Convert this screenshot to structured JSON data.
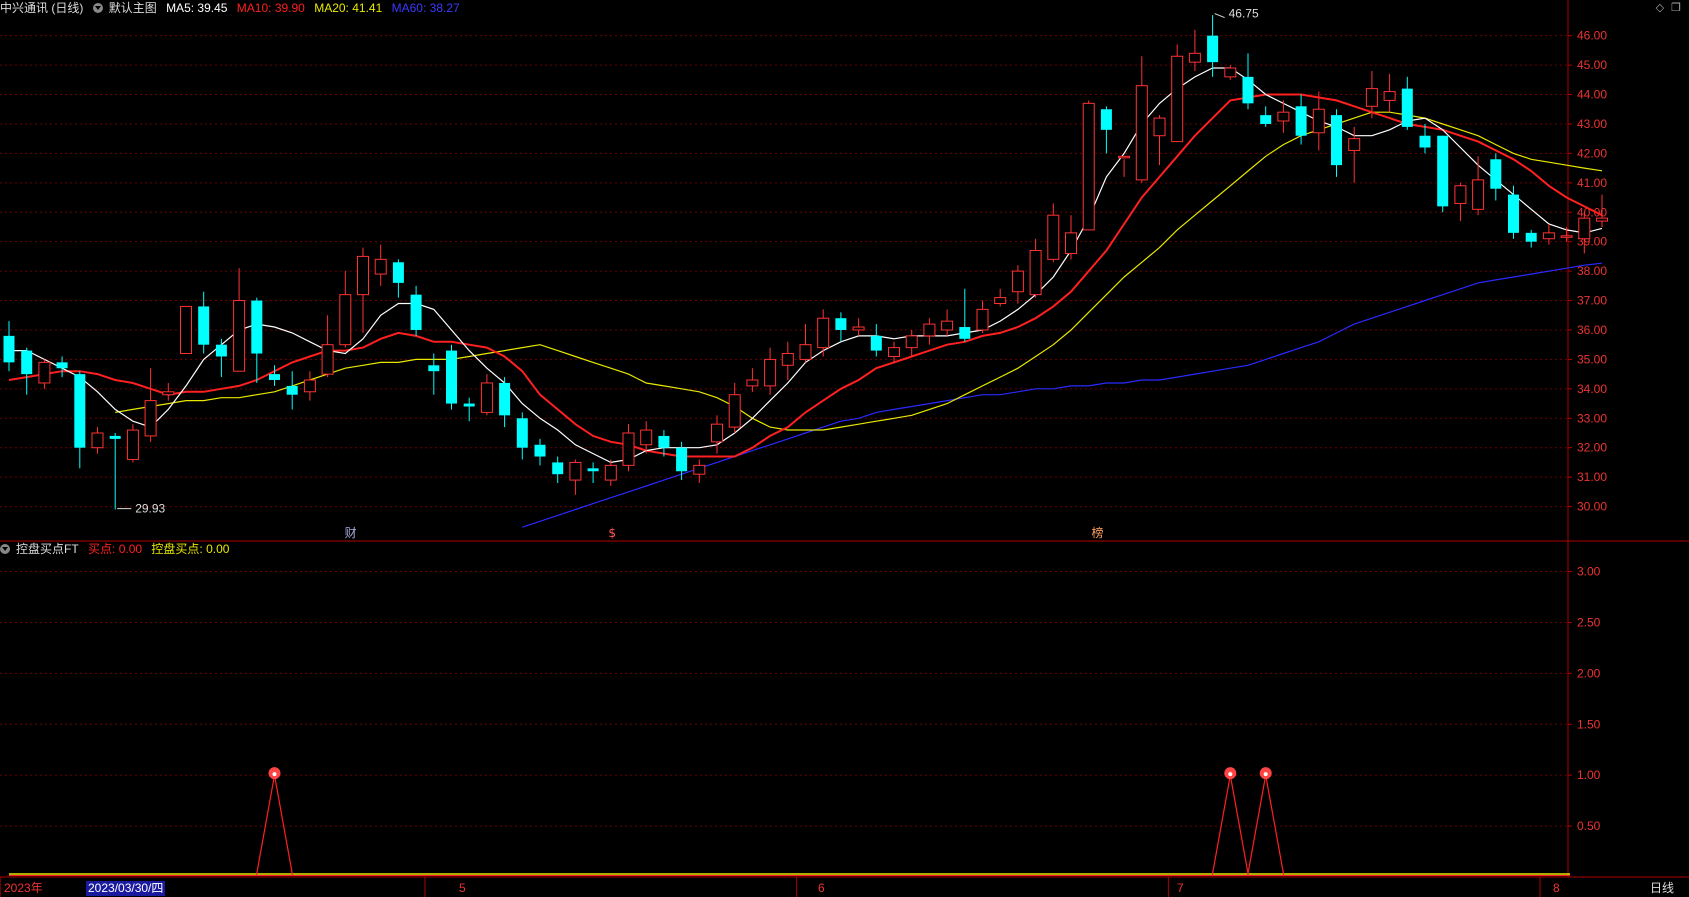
{
  "header": {
    "stock": "中兴通讯",
    "period": "(日线)",
    "template": "默认主图",
    "ma5_label": "MA5:",
    "ma5_value": "39.45",
    "ma10_label": "MA10:",
    "ma10_value": "39.90",
    "ma20_label": "MA20:",
    "ma20_value": "41.41",
    "ma60_label": "MA60:",
    "ma60_value": "38.27"
  },
  "window_tools": {
    "diamond": "◇",
    "restore": "❐"
  },
  "indicator": {
    "name": "控盘买点FT",
    "buy_label": "买点:",
    "buy_value": "0.00",
    "ctrl_label": "控盘买点:",
    "ctrl_value": "0.00"
  },
  "colors": {
    "up": "#ff3232",
    "down": "#00ffff",
    "ma5": "#ffffff",
    "ma10": "#ff2020",
    "ma20": "#e8e800",
    "ma60": "#2a2aff",
    "grid": "#6e0000",
    "axis_text": "#ee3333"
  },
  "markers": {
    "high": "46.75",
    "low": "29.93"
  },
  "events": [
    "财",
    "$",
    "榜"
  ],
  "footer": {
    "year": "2023年",
    "cursor_date": "2023/03/30/四",
    "months": [
      "5",
      "6",
      "7",
      "8"
    ],
    "period_button": "日线"
  },
  "chart_data": [
    {
      "type": "candlestick",
      "title": "中兴通讯 (日线)",
      "ylim": [
        29.0,
        46.6
      ],
      "yticks": [
        "46.00",
        "45.00",
        "44.00",
        "43.00",
        "42.00",
        "41.00",
        "40.00",
        "39.00",
        "38.00",
        "37.00",
        "36.00",
        "35.00",
        "34.00",
        "33.00",
        "32.00",
        "31.00",
        "30.00"
      ],
      "candles": [
        [
          35.8,
          34.9,
          36.3,
          34.6
        ],
        [
          35.3,
          34.5,
          35.4,
          33.8
        ],
        [
          34.2,
          34.9,
          35.0,
          34.0
        ],
        [
          34.9,
          34.7,
          35.1,
          34.4
        ],
        [
          34.5,
          32.0,
          34.6,
          31.3
        ],
        [
          32.0,
          32.5,
          32.7,
          31.8
        ],
        [
          32.4,
          32.3,
          32.5,
          29.9
        ],
        [
          31.6,
          32.6,
          32.8,
          31.5
        ],
        [
          32.4,
          33.6,
          34.7,
          32.2
        ],
        [
          33.8,
          33.9,
          34.2,
          33.6
        ],
        [
          35.2,
          36.8,
          36.8,
          35.2
        ],
        [
          36.8,
          35.5,
          37.3,
          35.2
        ],
        [
          35.5,
          35.1,
          35.7,
          34.4
        ],
        [
          34.6,
          37.0,
          38.1,
          34.6
        ],
        [
          37.0,
          35.2,
          37.1,
          34.2
        ],
        [
          34.5,
          34.3,
          34.8,
          34.1
        ],
        [
          34.1,
          33.8,
          34.6,
          33.3
        ],
        [
          33.9,
          34.3,
          34.6,
          33.6
        ],
        [
          34.5,
          35.5,
          36.5,
          34.4
        ],
        [
          35.5,
          37.2,
          38.0,
          35.4
        ],
        [
          37.2,
          38.5,
          38.8,
          35.9
        ],
        [
          37.9,
          38.4,
          38.9,
          37.5
        ],
        [
          38.3,
          37.6,
          38.4,
          37.1
        ],
        [
          37.2,
          36.0,
          37.5,
          35.8
        ],
        [
          34.8,
          34.6,
          35.2,
          33.8
        ],
        [
          35.3,
          33.5,
          35.5,
          33.3
        ],
        [
          33.5,
          33.4,
          33.7,
          32.9
        ],
        [
          33.2,
          34.2,
          34.5,
          33.1
        ],
        [
          34.2,
          33.1,
          34.4,
          32.7
        ],
        [
          33.0,
          32.0,
          33.2,
          31.6
        ],
        [
          32.1,
          31.7,
          32.3,
          31.4
        ],
        [
          31.5,
          31.1,
          31.7,
          30.8
        ],
        [
          30.9,
          31.5,
          31.6,
          30.4
        ],
        [
          31.3,
          31.2,
          31.5,
          30.8
        ],
        [
          30.9,
          31.4,
          31.6,
          30.7
        ],
        [
          31.4,
          32.5,
          32.8,
          31.2
        ],
        [
          32.1,
          32.6,
          32.9,
          31.8
        ],
        [
          32.4,
          32.0,
          32.6,
          31.7
        ],
        [
          32.0,
          31.2,
          32.2,
          30.9
        ],
        [
          31.1,
          31.4,
          31.6,
          30.8
        ],
        [
          32.2,
          32.8,
          33.1,
          31.8
        ],
        [
          32.7,
          33.8,
          34.2,
          32.5
        ],
        [
          34.1,
          34.3,
          34.7,
          33.9
        ],
        [
          34.1,
          35.0,
          35.4,
          33.8
        ],
        [
          34.8,
          35.2,
          35.6,
          34.3
        ],
        [
          35.0,
          35.5,
          36.2,
          34.9
        ],
        [
          35.4,
          36.4,
          36.7,
          35.1
        ],
        [
          36.4,
          36.0,
          36.6,
          35.6
        ],
        [
          36.0,
          36.1,
          36.4,
          35.8
        ],
        [
          35.8,
          35.3,
          36.2,
          35.1
        ],
        [
          35.1,
          35.4,
          35.6,
          34.9
        ],
        [
          35.4,
          35.8,
          36.0,
          35.1
        ],
        [
          35.8,
          36.2,
          36.4,
          35.5
        ],
        [
          36.0,
          36.3,
          36.7,
          35.8
        ],
        [
          36.1,
          35.7,
          37.4,
          35.6
        ],
        [
          36.0,
          36.7,
          37.0,
          35.9
        ],
        [
          36.9,
          37.1,
          37.4,
          36.8
        ],
        [
          37.3,
          38.0,
          38.2,
          36.9
        ],
        [
          37.2,
          38.7,
          39.1,
          37.1
        ],
        [
          38.4,
          39.9,
          40.3,
          38.3
        ],
        [
          38.6,
          39.3,
          39.9,
          38.4
        ],
        [
          39.4,
          43.7,
          43.8,
          39.6
        ],
        [
          43.5,
          42.8,
          43.6,
          42.0
        ],
        [
          41.9,
          41.9,
          41.8,
          41.2
        ],
        [
          41.1,
          44.3,
          45.3,
          41.0
        ],
        [
          42.6,
          43.2,
          43.3,
          41.6
        ],
        [
          42.4,
          45.3,
          45.7,
          42.4
        ],
        [
          45.1,
          45.4,
          46.2,
          44.8
        ],
        [
          46.0,
          45.1,
          46.7,
          44.6
        ],
        [
          44.6,
          44.9,
          45.0,
          44.5
        ],
        [
          44.6,
          43.7,
          45.4,
          43.5
        ],
        [
          43.3,
          43.0,
          43.6,
          42.9
        ],
        [
          43.1,
          43.4,
          43.8,
          42.7
        ],
        [
          43.6,
          42.6,
          44.0,
          42.3
        ],
        [
          42.7,
          43.5,
          44.1,
          42.1
        ],
        [
          43.3,
          41.6,
          43.5,
          41.2
        ],
        [
          42.1,
          42.5,
          42.9,
          41.0
        ],
        [
          43.6,
          44.2,
          44.8,
          43.2
        ],
        [
          43.8,
          44.1,
          44.7,
          43.4
        ],
        [
          44.2,
          42.9,
          44.6,
          42.8
        ],
        [
          42.6,
          42.2,
          43.0,
          42.0
        ],
        [
          42.6,
          40.2,
          42.6,
          40.0
        ],
        [
          40.3,
          40.9,
          41.0,
          39.7
        ],
        [
          40.1,
          41.1,
          41.9,
          39.9
        ],
        [
          41.8,
          40.8,
          42.0,
          40.4
        ],
        [
          40.6,
          39.3,
          40.9,
          39.1
        ],
        [
          39.3,
          39.0,
          39.4,
          38.8
        ],
        [
          39.1,
          39.3,
          39.6,
          38.9
        ],
        [
          39.2,
          39.2,
          39.5,
          39.0
        ],
        [
          39.1,
          39.8,
          40.0,
          38.6
        ],
        [
          39.7,
          39.8,
          40.6,
          39.5
        ]
      ],
      "series": [
        {
          "name": "MA5",
          "values": [
            35.3,
            35.3,
            35.0,
            34.7,
            34.4,
            33.9,
            33.3,
            32.9,
            32.7,
            33.3,
            34.1,
            35.0,
            35.5,
            36.0,
            36.2,
            36.1,
            35.9,
            35.6,
            35.3,
            35.2,
            35.7,
            36.5,
            36.9,
            36.9,
            36.7,
            36.0,
            35.3,
            34.7,
            34.2,
            33.5,
            33.0,
            32.6,
            32.1,
            31.8,
            31.5,
            31.6,
            31.9,
            32.0,
            32.0,
            32.0,
            32.1,
            32.5,
            33.0,
            33.6,
            34.2,
            34.9,
            35.3,
            35.6,
            35.8,
            35.8,
            35.7,
            35.8,
            35.8,
            35.8,
            35.9,
            36.0,
            36.3,
            36.7,
            37.2,
            37.8,
            38.7,
            39.8,
            41.2,
            42.0,
            43.0,
            43.7,
            44.2,
            44.6,
            44.9,
            44.9,
            44.5,
            44.0,
            43.7,
            43.4,
            43.1,
            42.9,
            42.6,
            42.6,
            42.8,
            43.1,
            43.2,
            42.8,
            42.2,
            41.6,
            41.1,
            40.6,
            40.1,
            39.6,
            39.4,
            39.3,
            39.45
          ]
        },
        {
          "name": "MA10",
          "values": [
            34.3,
            34.4,
            34.5,
            34.6,
            34.6,
            34.5,
            34.3,
            34.2,
            34.0,
            33.8,
            33.9,
            33.9,
            34.0,
            34.1,
            34.3,
            34.6,
            34.9,
            35.1,
            35.3,
            35.3,
            35.4,
            35.7,
            35.9,
            35.8,
            35.6,
            35.6,
            35.5,
            35.4,
            35.1,
            34.6,
            33.8,
            33.3,
            32.8,
            32.4,
            32.2,
            32.1,
            31.9,
            31.8,
            31.7,
            31.7,
            31.7,
            31.7,
            32.0,
            32.4,
            32.7,
            33.2,
            33.6,
            34.0,
            34.3,
            34.7,
            34.9,
            35.1,
            35.3,
            35.5,
            35.6,
            35.8,
            35.9,
            36.1,
            36.4,
            36.8,
            37.3,
            38.0,
            38.7,
            39.6,
            40.5,
            41.2,
            41.9,
            42.6,
            43.2,
            43.8,
            43.9,
            44.0,
            44.0,
            44.0,
            43.9,
            43.8,
            43.6,
            43.4,
            43.2,
            43.0,
            42.9,
            42.8,
            42.6,
            42.4,
            42.1,
            41.8,
            41.4,
            40.9,
            40.5,
            40.2,
            39.9
          ]
        },
        {
          "name": "MA20",
          "values": [
            33.2,
            33.3,
            33.4,
            33.5,
            33.6,
            33.6,
            33.7,
            33.7,
            33.8,
            33.9,
            34.1,
            34.3,
            34.5,
            34.7,
            34.8,
            34.9,
            34.9,
            35.0,
            35.0,
            35.0,
            35.1,
            35.2,
            35.3,
            35.4,
            35.5,
            35.3,
            35.1,
            34.9,
            34.7,
            34.5,
            34.2,
            34.1,
            34.0,
            33.9,
            33.7,
            33.4,
            33.0,
            32.7,
            32.6,
            32.6,
            32.6,
            32.7,
            32.8,
            32.9,
            33.0,
            33.1,
            33.3,
            33.5,
            33.8,
            34.1,
            34.4,
            34.7,
            35.1,
            35.5,
            36.0,
            36.6,
            37.2,
            37.8,
            38.3,
            38.8,
            39.4,
            39.9,
            40.4,
            40.9,
            41.4,
            41.9,
            42.3,
            42.6,
            42.8,
            43.0,
            43.2,
            43.4,
            43.4,
            43.3,
            43.2,
            43.0,
            42.8,
            42.6,
            42.3,
            42.0,
            41.8,
            41.7,
            41.6,
            41.5,
            41.41
          ]
        },
        {
          "name": "MA60",
          "values": [
            29.3,
            29.5,
            29.7,
            29.9,
            30.1,
            30.3,
            30.5,
            30.7,
            30.9,
            31.1,
            31.3,
            31.5,
            31.7,
            31.9,
            32.1,
            32.3,
            32.5,
            32.7,
            32.9,
            33.0,
            33.2,
            33.3,
            33.4,
            33.5,
            33.6,
            33.7,
            33.8,
            33.8,
            33.9,
            34.0,
            34.0,
            34.1,
            34.1,
            34.2,
            34.2,
            34.3,
            34.3,
            34.4,
            34.5,
            34.6,
            34.7,
            34.8,
            35.0,
            35.2,
            35.4,
            35.6,
            35.9,
            36.2,
            36.4,
            36.6,
            36.8,
            37.0,
            37.2,
            37.4,
            37.6,
            37.7,
            37.8,
            37.9,
            38.0,
            38.1,
            38.2,
            38.27
          ]
        }
      ]
    },
    {
      "type": "line",
      "title": "控盘买点FT",
      "ylim": [
        0,
        3.3
      ],
      "yticks": [
        "3.00",
        "2.50",
        "2.00",
        "1.50",
        "1.00",
        "0.50"
      ],
      "signal_days": [
        15,
        69,
        71
      ]
    }
  ]
}
